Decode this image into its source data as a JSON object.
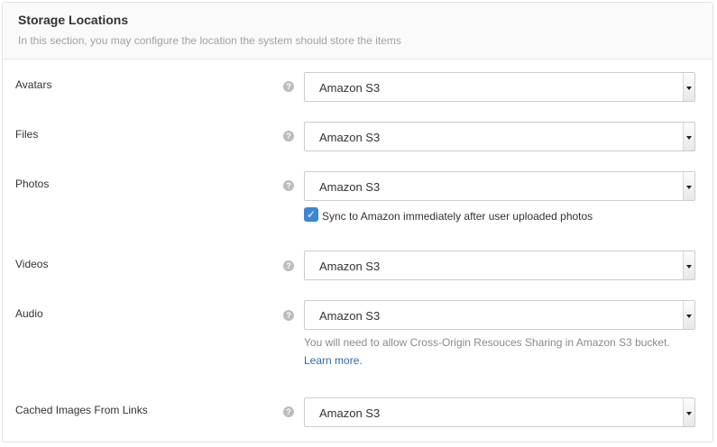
{
  "header": {
    "title": "Storage Locations",
    "description": "In this section, you may configure the location the system should store the items"
  },
  "rows": [
    {
      "label": "Avatars",
      "value": "Amazon S3"
    },
    {
      "label": "Files",
      "value": "Amazon S3"
    },
    {
      "label": "Photos",
      "value": "Amazon S3"
    },
    {
      "label": "Videos",
      "value": "Amazon S3"
    },
    {
      "label": "Audio",
      "value": "Amazon S3"
    },
    {
      "label": "Cached Images From Links",
      "value": "Amazon S3"
    }
  ],
  "help_icon": {
    "glyph": "?",
    "name": "help-icon"
  },
  "photos_sync": {
    "checked": true,
    "check_glyph": "✓",
    "label": "Sync to Amazon immediately after user uploaded photos"
  },
  "audio_hint": {
    "text": "You will need to allow Cross-Origin Resouces Sharing in Amazon S3 bucket.",
    "link": "Learn more."
  },
  "colors": {
    "accent": "#3d85d8",
    "link": "#2b6cb0",
    "muted": "#a2a2a2"
  }
}
